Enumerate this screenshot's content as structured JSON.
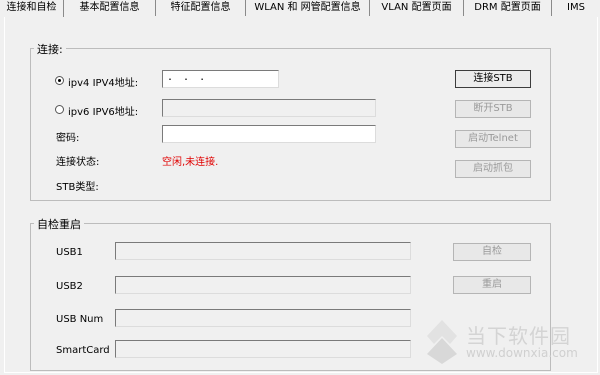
{
  "tabs": [
    {
      "label": "连接和自检",
      "active": true
    },
    {
      "label": "基本配置信息",
      "active": false
    },
    {
      "label": "特征配置信息",
      "active": false
    },
    {
      "label": "WLAN 和 网管配置信息",
      "active": false
    },
    {
      "label": "VLAN 配置页面",
      "active": false
    },
    {
      "label": "DRM 配置页面",
      "active": false
    },
    {
      "label": "IMS",
      "active": false
    }
  ],
  "connect": {
    "group_title": "连接:",
    "ipv4_label": "ipv4  IPV4地址:",
    "ipv4_value": ".    .    .",
    "ipv4_selected": true,
    "ipv6_label": "ipv6  IPV6地址:",
    "ipv6_value": "",
    "password_label": "密码:",
    "password_value": "",
    "status_label": "连接状态:",
    "status_value": "空闲,未连接.",
    "stb_type_label": "STB类型:",
    "stb_type_value": "",
    "buttons": {
      "connect": "连接STB",
      "disconnect": "断开STB",
      "telnet": "启动Telnet",
      "capture": "启动抓包"
    }
  },
  "selfcheck": {
    "group_title": "自检重启",
    "usb1_label": "USB1",
    "usb1_value": "",
    "usb2_label": "USB2",
    "usb2_value": "",
    "usbnum_label": "USB Num",
    "usbnum_value": "",
    "smartcard_label": "SmartCard",
    "smartcard_value": "",
    "buttons": {
      "selfcheck": "自检",
      "restart": "重启"
    }
  },
  "watermark": {
    "brand": "当下软件园",
    "url": "www.downxia.com"
  },
  "colors": {
    "status_red": "#e00000",
    "background": "#f0f0f0"
  }
}
